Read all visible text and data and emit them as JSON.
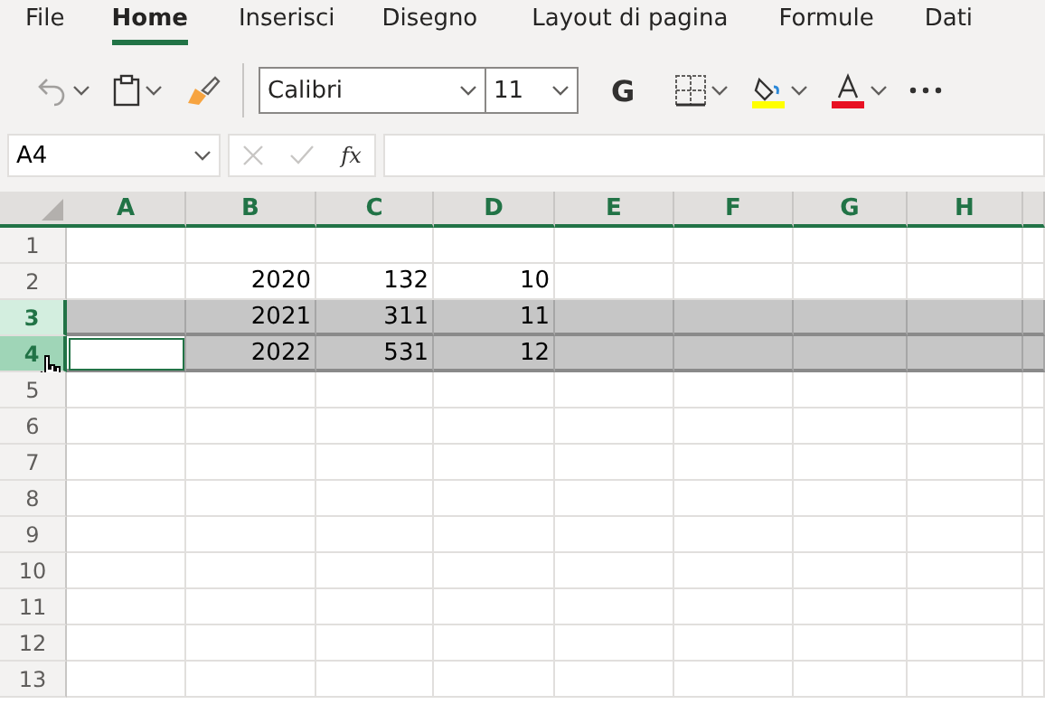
{
  "tabs": [
    {
      "label": "File",
      "selected": false
    },
    {
      "label": "Home",
      "selected": true
    },
    {
      "label": "Inserisci",
      "selected": false
    },
    {
      "label": "Disegno",
      "selected": false
    },
    {
      "label": "Layout di pagina",
      "selected": false
    },
    {
      "label": "Formule",
      "selected": false
    },
    {
      "label": "Dati",
      "selected": false
    }
  ],
  "toolbar": {
    "font": "Calibri",
    "size": "11",
    "bold": "G"
  },
  "formula_bar": {
    "name_box": "A4",
    "fx": "fx"
  },
  "sheet": {
    "columns": [
      "A",
      "B",
      "C",
      "D",
      "E",
      "F",
      "G",
      "H"
    ],
    "rows": [
      {
        "header": "1",
        "selected": false,
        "active": false
      },
      {
        "header": "2",
        "selected": false,
        "active": false,
        "values": [
          "2020",
          "132",
          "10"
        ]
      },
      {
        "header": "3",
        "selected": true,
        "active": false,
        "values": [
          "2021",
          "311",
          "11"
        ]
      },
      {
        "header": "4",
        "selected": true,
        "active": true,
        "values": [
          "2022",
          "531",
          "12"
        ]
      },
      {
        "header": "5",
        "selected": false,
        "active": false
      },
      {
        "header": "6",
        "selected": false,
        "active": false
      },
      {
        "header": "7",
        "selected": false,
        "active": false
      },
      {
        "header": "8",
        "selected": false,
        "active": false
      },
      {
        "header": "9",
        "selected": false,
        "active": false
      },
      {
        "header": "10",
        "selected": false,
        "active": false
      },
      {
        "header": "11",
        "selected": false,
        "active": false
      },
      {
        "header": "12",
        "selected": false,
        "active": false
      },
      {
        "header": "13",
        "selected": false,
        "active": false
      }
    ]
  }
}
